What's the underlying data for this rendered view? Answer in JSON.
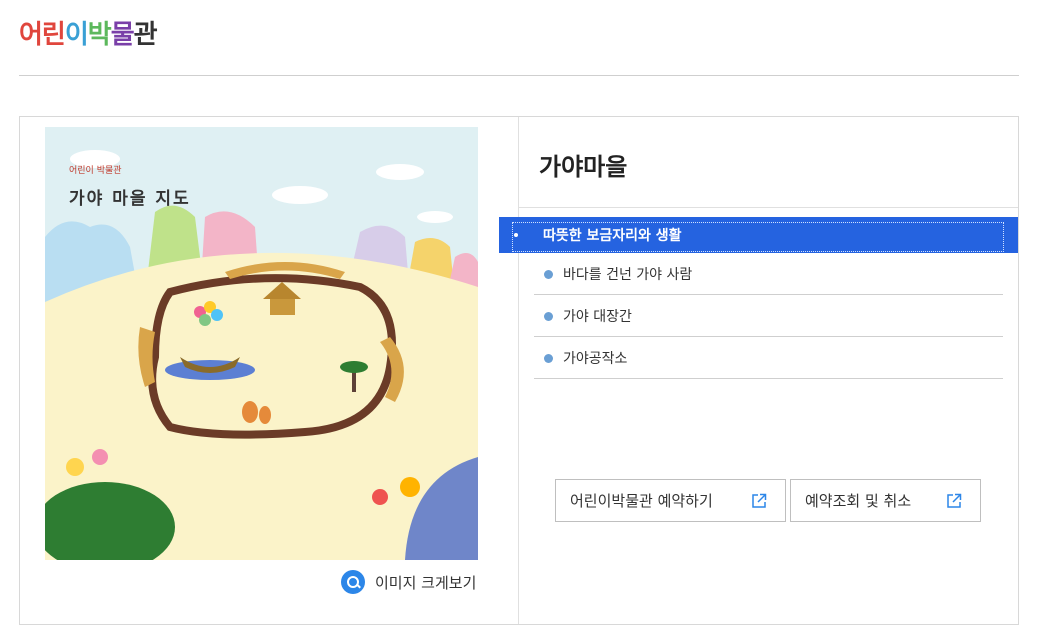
{
  "header": {
    "title_chars": [
      {
        "ch": "어",
        "color": "#e0463d"
      },
      {
        "ch": "린",
        "color": "#e0463d"
      },
      {
        "ch": "이",
        "color": "#3aa0d5"
      },
      {
        "ch": "박",
        "color": "#5cb85c"
      },
      {
        "ch": "물",
        "color": "#7a3fa8"
      },
      {
        "ch": "관",
        "color": "#333333"
      }
    ]
  },
  "map": {
    "small_title": "어린이 박물관",
    "title": "가야 마을 지도",
    "zoom_label": "이미지 크게보기"
  },
  "section": {
    "title": "가야마을"
  },
  "menu": {
    "items": [
      {
        "label": "따뜻한 보금자리와 생활",
        "active": true
      },
      {
        "label": "바다를 건넌 가야 사람",
        "active": false
      },
      {
        "label": "가야 대장간",
        "active": false
      },
      {
        "label": "가야공작소",
        "active": false
      }
    ]
  },
  "buttons": {
    "reserve_label": "어린이박물관 예약하기",
    "lookup_label": "예약조회 및 취소"
  },
  "colors": {
    "accent": "#2563e0",
    "bullet": "#6a9fd4",
    "zoom_icon": "#2c86e8"
  }
}
